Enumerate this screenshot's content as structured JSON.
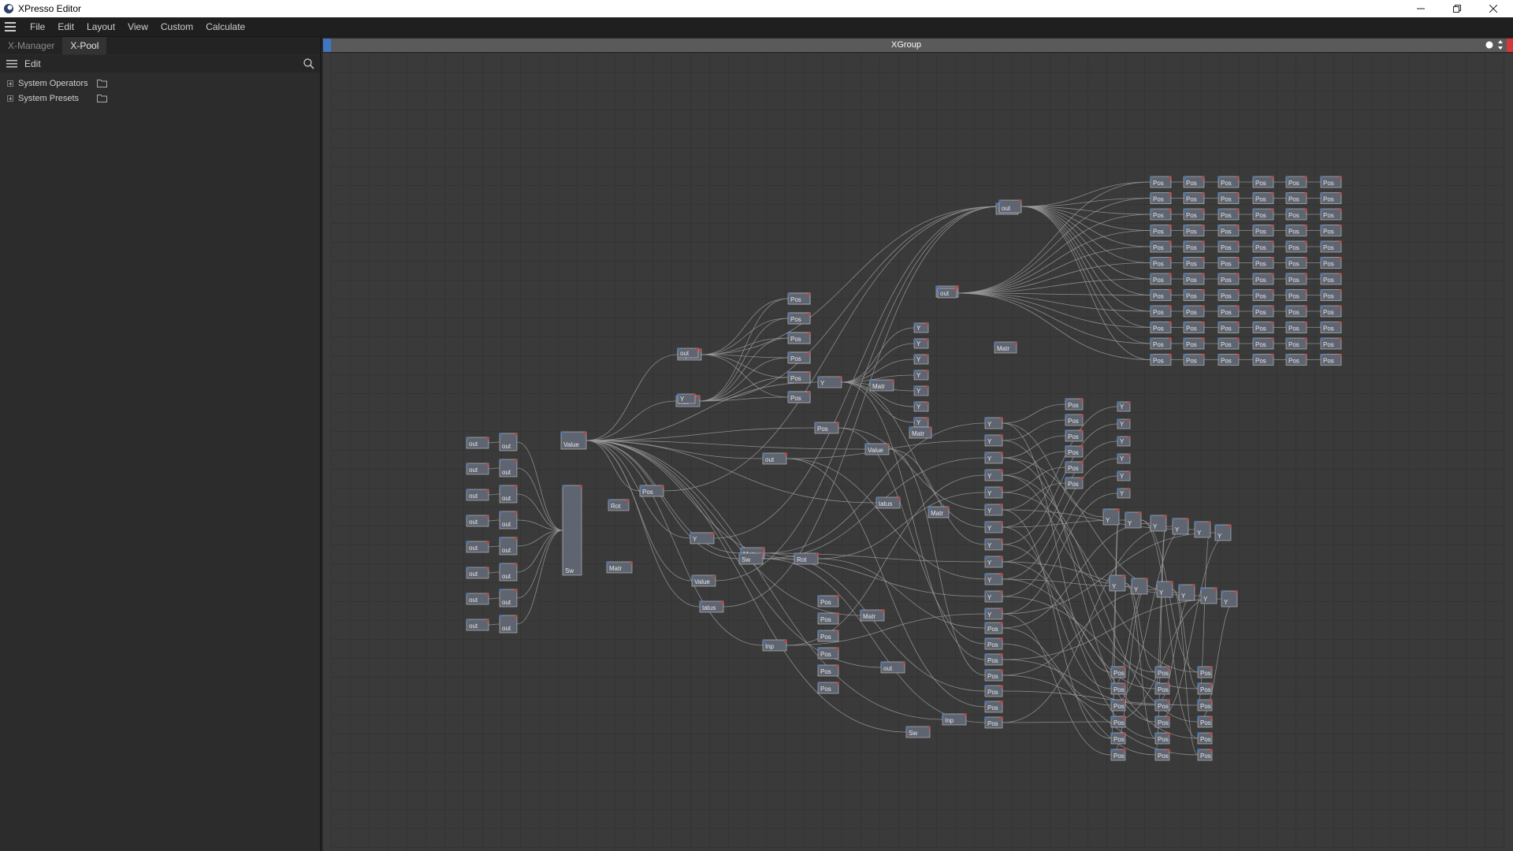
{
  "window": {
    "title": "XPresso Editor",
    "controls": [
      "minimize-icon",
      "restore-icon",
      "close-icon"
    ]
  },
  "menu": {
    "items": [
      "File",
      "Edit",
      "Layout",
      "View",
      "Custom",
      "Calculate"
    ]
  },
  "left_panel": {
    "tabs": [
      {
        "label": "X-Manager",
        "active": false
      },
      {
        "label": "X-Pool",
        "active": true
      }
    ],
    "toolbar": {
      "edit_label": "Edit"
    },
    "tree": [
      {
        "label": "System Operators"
      },
      {
        "label": "System Presets"
      }
    ]
  },
  "editor": {
    "group_title": "XGroup"
  },
  "colors": {
    "accent_blue": "#3f77c2",
    "close_red": "#d23a3a",
    "canvas_bg": "#3a3a3a",
    "node_fill": "#5e6470"
  },
  "graph": {
    "node_labels": [
      "out",
      "Sw",
      "Inp",
      "Rot",
      "Pos",
      "Y",
      "Value",
      "tatus",
      "Matr"
    ]
  }
}
